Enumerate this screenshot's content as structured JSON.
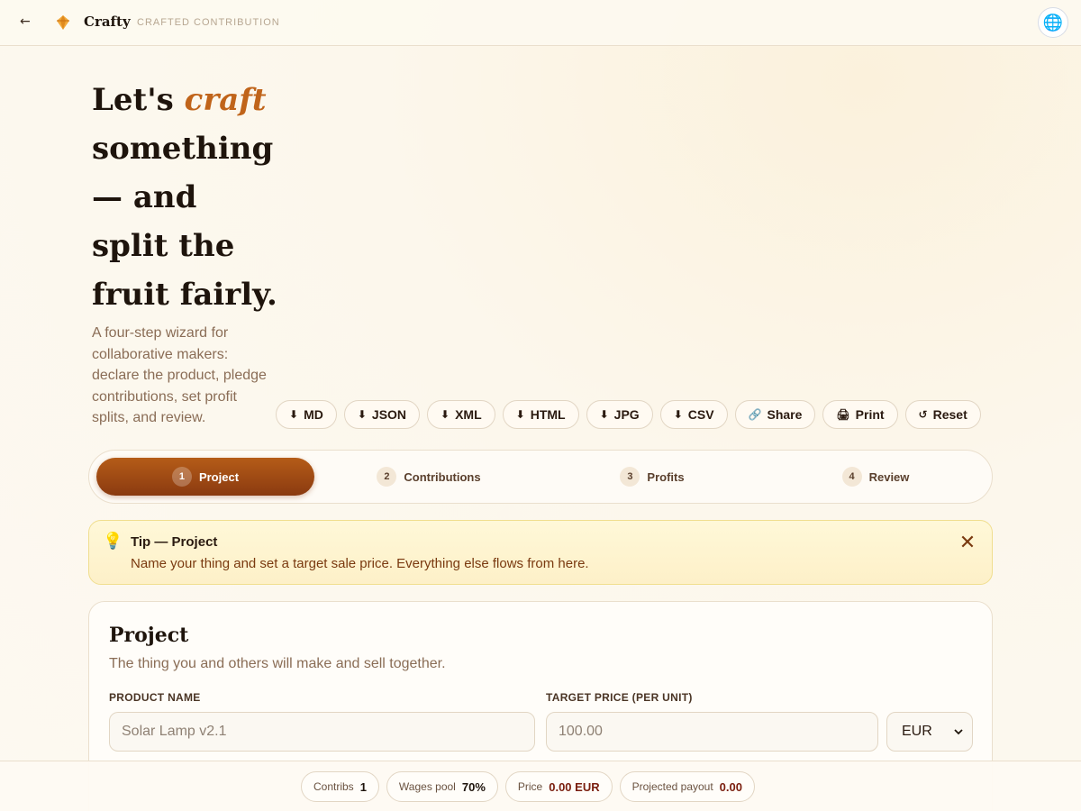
{
  "header": {
    "back": "←",
    "brand": "Crafty",
    "tagline": "CRAFTED CONTRIBUTION",
    "globe_icon": "🌐"
  },
  "hero": {
    "title_pre": "Let's ",
    "title_accent": "craft",
    "title_post": " something — and split the fruit fairly.",
    "subtitle": "A four-step wizard for collaborative makers: declare the product, pledge contributions, set profit splits, and review."
  },
  "actions": [
    {
      "icon": "⬇",
      "label": "MD"
    },
    {
      "icon": "⬇",
      "label": "JSON"
    },
    {
      "icon": "⬇",
      "label": "XML"
    },
    {
      "icon": "⬇",
      "label": "HTML"
    },
    {
      "icon": "⬇",
      "label": "JPG"
    },
    {
      "icon": "⬇",
      "label": "CSV"
    },
    {
      "icon": "🔗",
      "label": "Share"
    },
    {
      "icon": "🖨",
      "label": "Print"
    },
    {
      "icon": "↺",
      "label": "Reset"
    }
  ],
  "steps": [
    {
      "num": "1",
      "label": "Project",
      "active": true
    },
    {
      "num": "2",
      "label": "Contributions",
      "active": false
    },
    {
      "num": "3",
      "label": "Profits",
      "active": false
    },
    {
      "num": "4",
      "label": "Review",
      "active": false
    }
  ],
  "tip": {
    "icon": "💡",
    "title": "Tip — Project",
    "text": "Name your thing and set a target sale price. Everything else flows from here.",
    "close": "✕"
  },
  "project": {
    "title": "Project",
    "subtitle": "The thing you and others will make and sell together.",
    "product_label": "PRODUCT NAME",
    "product_placeholder": "Solar Lamp v2.1",
    "price_label": "TARGET PRICE (PER UNIT)",
    "price_placeholder": "100.00",
    "currency": "EUR"
  },
  "status": {
    "contribs_label": "Contribs",
    "contribs_value": "1",
    "wages_label": "Wages pool",
    "wages_value": "70%",
    "price_label": "Price",
    "price_value": "0.00 EUR",
    "payout_label": "Projected payout",
    "payout_value": "0.00"
  },
  "colors": {
    "accent": "#c0641a",
    "active_step": "#a04c14",
    "tip_bg": "#fff8d8"
  }
}
